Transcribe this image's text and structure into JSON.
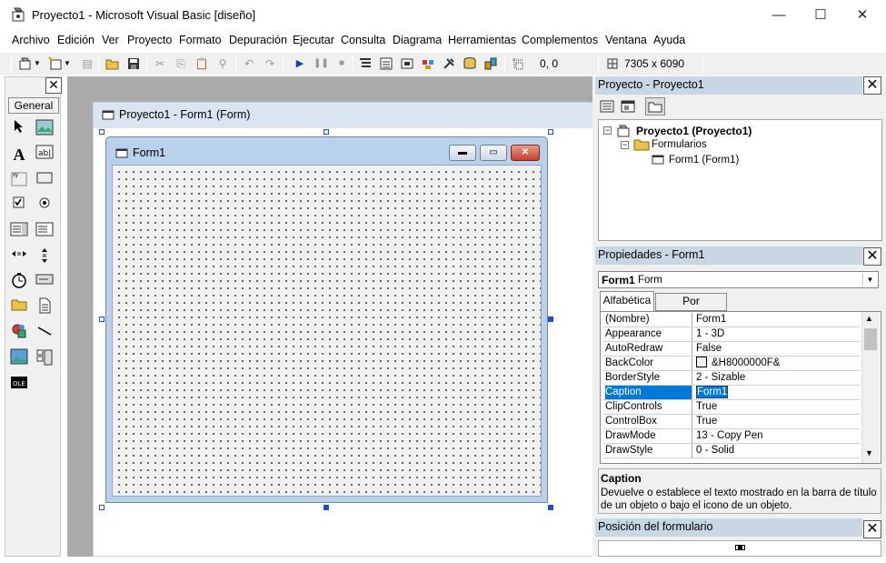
{
  "window": {
    "title": "Proyecto1 - Microsoft Visual Basic [diseño]",
    "minimize": "—",
    "maximize": "☐",
    "close": "✕"
  },
  "menu": [
    {
      "label": "Archivo"
    },
    {
      "label": "Edición"
    },
    {
      "label": "Ver"
    },
    {
      "label": "Proyecto"
    },
    {
      "label": "Formato"
    },
    {
      "label": "Depuración"
    },
    {
      "label": "Ejecutar"
    },
    {
      "label": "Consulta"
    },
    {
      "label": "Diagrama"
    },
    {
      "label": "Herramientas"
    },
    {
      "label": "Complementos"
    },
    {
      "label": "Ventana"
    },
    {
      "label": "Ayuda"
    }
  ],
  "toolbar": {
    "position": "0, 0",
    "size": "7305 x 6090"
  },
  "toolbox": {
    "close": "✕",
    "tab": "General"
  },
  "designer": {
    "window_title": "Proyecto1 - Form1 (Form)",
    "form_caption": "Form1"
  },
  "project": {
    "title": "Proyecto - Proyecto1",
    "close": "✕",
    "root": "Proyecto1 (Proyecto1)",
    "folder": "Formularios",
    "item": "Form1 (Form1)"
  },
  "properties": {
    "title": "Propiedades - Form1",
    "close": "✕",
    "object_name": "Form1",
    "object_type": "Form",
    "tab_alpha": "Alfabética",
    "tab_cat": "Por categorías",
    "rows": [
      {
        "name": "(Nombre)",
        "value": "Form1"
      },
      {
        "name": "Appearance",
        "value": "1 - 3D"
      },
      {
        "name": "AutoRedraw",
        "value": "False"
      },
      {
        "name": "BackColor",
        "value": "&H8000000F&"
      },
      {
        "name": "BorderStyle",
        "value": "2 - Sizable"
      },
      {
        "name": "Caption",
        "value": "Form1"
      },
      {
        "name": "ClipControls",
        "value": "True"
      },
      {
        "name": "ControlBox",
        "value": "True"
      },
      {
        "name": "DrawMode",
        "value": "13 - Copy Pen"
      },
      {
        "name": "DrawStyle",
        "value": "0 - Solid"
      }
    ],
    "desc_title": "Caption",
    "desc_text": "Devuelve o establece el texto mostrado en la barra de título de un objeto o bajo el icono de un objeto."
  },
  "form_layout": {
    "title": "Posición del formulario",
    "close": "✕"
  },
  "colors": {
    "accent": "#0078d7",
    "panel_title": "#c9d6e4",
    "designer_bg": "#ababab"
  }
}
